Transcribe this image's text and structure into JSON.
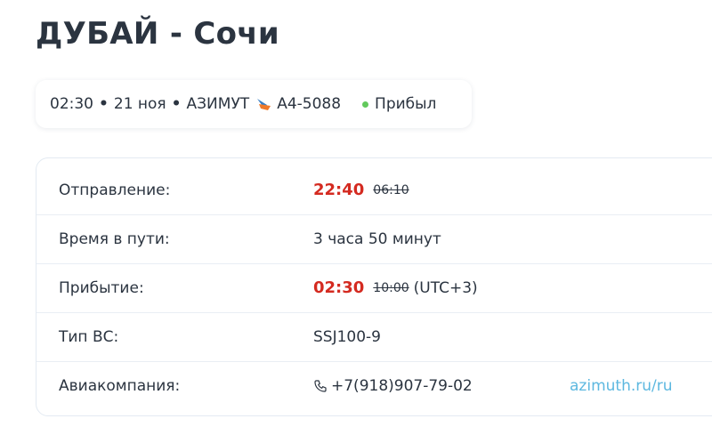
{
  "header": {
    "title": "ДУБАЙ - Сочи"
  },
  "summary": {
    "time": "02:30",
    "separator": "•",
    "date": "21 ноя",
    "airline": "АЗИМУТ",
    "airline_logo_icon": "azimut-logo-icon",
    "flight_number": "А4-5088",
    "status": "Прибыл",
    "status_color": "#62c95c"
  },
  "details": {
    "departure": {
      "label": "Отправление:",
      "actual": "22:40",
      "scheduled": "06:10"
    },
    "duration": {
      "label": "Время в пути:",
      "value": "3 часа 50 минут"
    },
    "arrival": {
      "label": "Прибытие:",
      "actual": "02:30",
      "scheduled": "10:00",
      "timezone": "(UTC+3)"
    },
    "aircraft": {
      "label": "Тип ВС:",
      "value": "SSJ100-9"
    },
    "airline": {
      "label": "Авиакомпания:",
      "phone_icon": "phone-icon",
      "phone": "+7(918)907-79-02",
      "website": "azimuth.ru/ru"
    }
  },
  "colors": {
    "delayed_time": "#d42a20",
    "link": "#5db8e0",
    "text": "#2b3440"
  }
}
